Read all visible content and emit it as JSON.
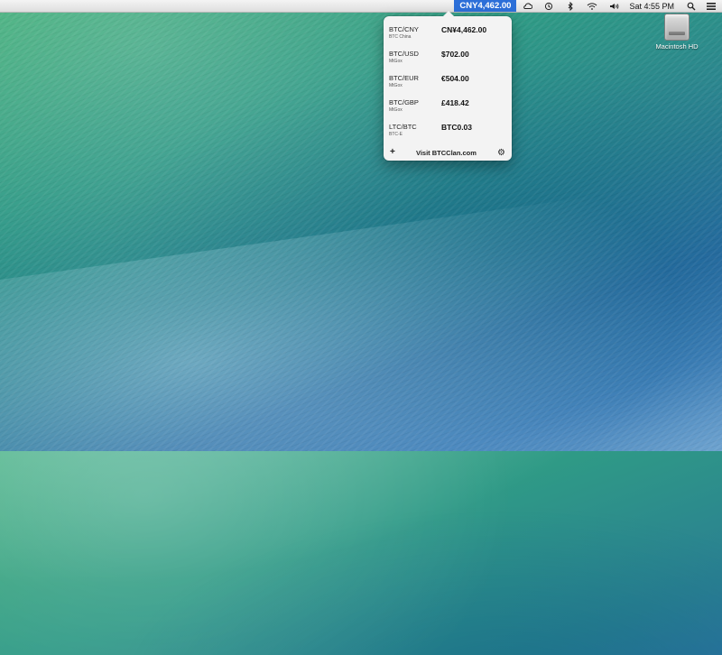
{
  "menubar": {
    "price": "CNY4,462.00",
    "icons": [
      "cloud-sync-icon",
      "time-machine-icon",
      "bluetooth-icon",
      "wifi-icon",
      "volume-icon"
    ],
    "clock": "Sat 4:55 PM"
  },
  "popover": {
    "rows": [
      {
        "pair": "BTC/CNY",
        "source": "BTC China",
        "price": "CN¥4,462.00"
      },
      {
        "pair": "BTC/USD",
        "source": "MtGox",
        "price": "$702.00"
      },
      {
        "pair": "BTC/EUR",
        "source": "MtGox",
        "price": "€504.00"
      },
      {
        "pair": "BTC/GBP",
        "source": "MtGox",
        "price": "£418.42"
      },
      {
        "pair": "LTC/BTC",
        "source": "BTC-E",
        "price": "BTC0.03"
      }
    ],
    "footer": {
      "add": "+",
      "link": "Visit BTCClan.com",
      "settings": "⚙"
    }
  },
  "desktop": {
    "hd_label": "Macintosh HD"
  },
  "colors": {
    "menubar_price_bg": "#2c6fd8"
  }
}
